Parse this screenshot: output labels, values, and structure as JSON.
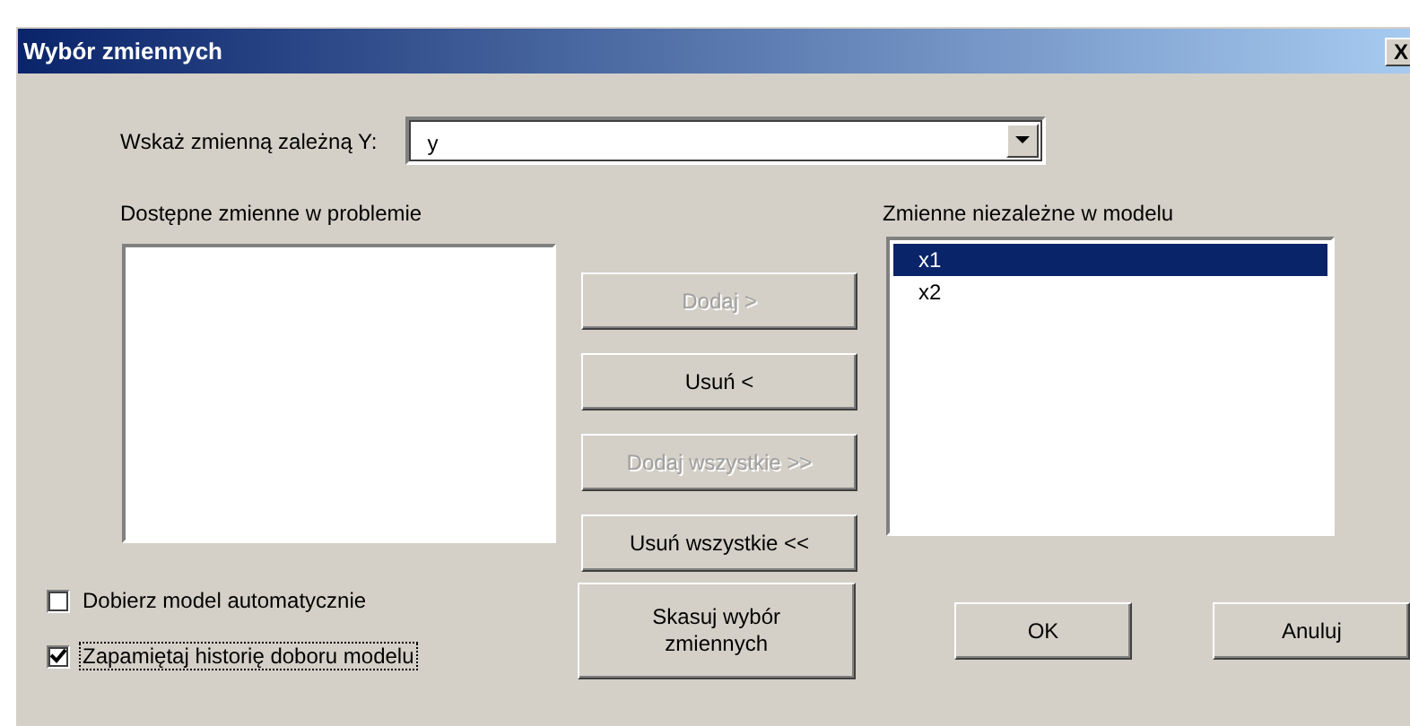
{
  "window": {
    "title": "Wybór zmiennych",
    "close": "X"
  },
  "dependent": {
    "label": "Wskaż zmienną zależną Y:",
    "value": "y"
  },
  "available": {
    "label": "Dostępne zmienne w problemie"
  },
  "model": {
    "label": "Zmienne niezależne w modelu",
    "items": [
      {
        "text": "x1",
        "selected": true
      },
      {
        "text": "x2",
        "selected": false
      }
    ]
  },
  "move_buttons": [
    {
      "label": "Dodaj >",
      "disabled": true
    },
    {
      "label": "Usuń <",
      "disabled": false
    },
    {
      "label": "Dodaj  wszystkie >>",
      "disabled": true
    },
    {
      "label": "Usuń wszystkie <<",
      "disabled": false
    }
  ],
  "options": [
    {
      "label": "Dobierz model automatycznie",
      "checked": false,
      "focused": false
    },
    {
      "label": "Zapamiętaj historię doboru modelu",
      "checked": true,
      "focused": true
    }
  ],
  "clear_button": {
    "label": "Skasuj wybór zmiennych"
  },
  "buttons": [
    "OK",
    "Anuluj"
  ]
}
